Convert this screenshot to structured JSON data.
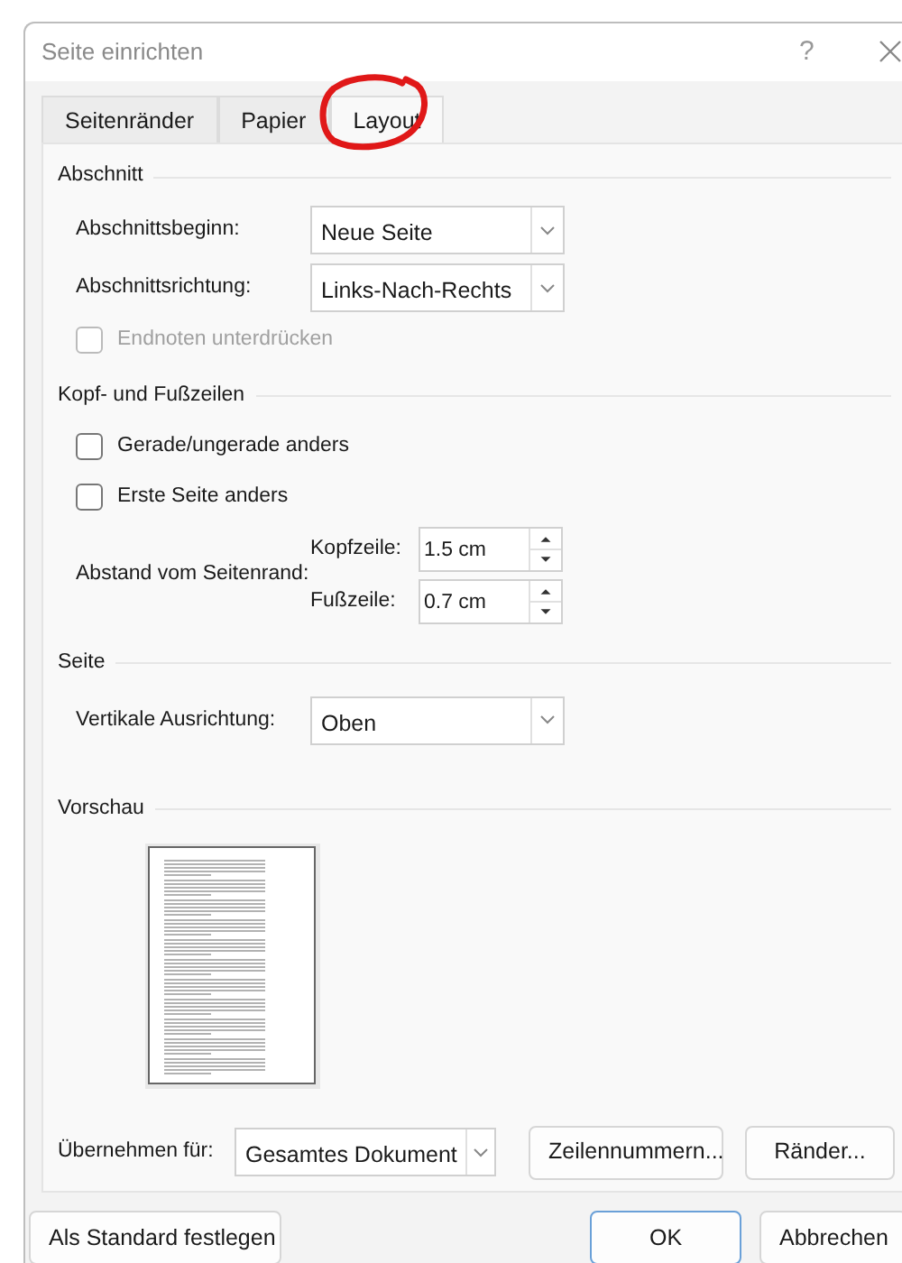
{
  "window": {
    "title": "Seite einrichten",
    "help": "?"
  },
  "tabs": [
    {
      "label": "Seitenränder",
      "selected": false,
      "circled": false
    },
    {
      "label": "Papier",
      "selected": false,
      "circled": false
    },
    {
      "label": "Layout",
      "selected": true,
      "circled": true
    }
  ],
  "section": {
    "title": "Abschnitt",
    "dropdowns": [
      {
        "label": "Abschnittsbeginn:",
        "value": "Neue Seite"
      },
      {
        "label": "Abschnittsrichtung:",
        "value": "Links-Nach-Rechts"
      }
    ],
    "endnotes": {
      "label": "Endnoten unterdrücken",
      "checked": false,
      "disabled": true
    }
  },
  "headers_footers": {
    "title": "Kopf- und Fußzeilen",
    "checkboxes": [
      {
        "label": "Gerade/ungerade anders",
        "checked": false,
        "disabled": false
      },
      {
        "label": "Erste Seite anders",
        "checked": false,
        "disabled": false
      }
    ],
    "distance_label": "Abstand vom Seitenrand:",
    "spinners": [
      {
        "label": "Kopfzeile:",
        "value": "1.5 cm"
      },
      {
        "label": "Fußzeile:",
        "value": "0.7 cm"
      }
    ]
  },
  "page": {
    "title": "Seite",
    "dropdown": {
      "label": "Vertikale Ausrichtung:",
      "value": "Oben"
    }
  },
  "preview": {
    "title": "Vorschau"
  },
  "apply_to": {
    "label": "Übernehmen für:",
    "value": "Gesamtes Dokument"
  },
  "panel_buttons": [
    "Zeilennummern...",
    "Ränder..."
  ],
  "footer_buttons": [
    {
      "label": "Als Standard festlegen",
      "default": false
    },
    {
      "label": "OK",
      "default": true
    },
    {
      "label": "Abbrechen",
      "default": false
    }
  ]
}
